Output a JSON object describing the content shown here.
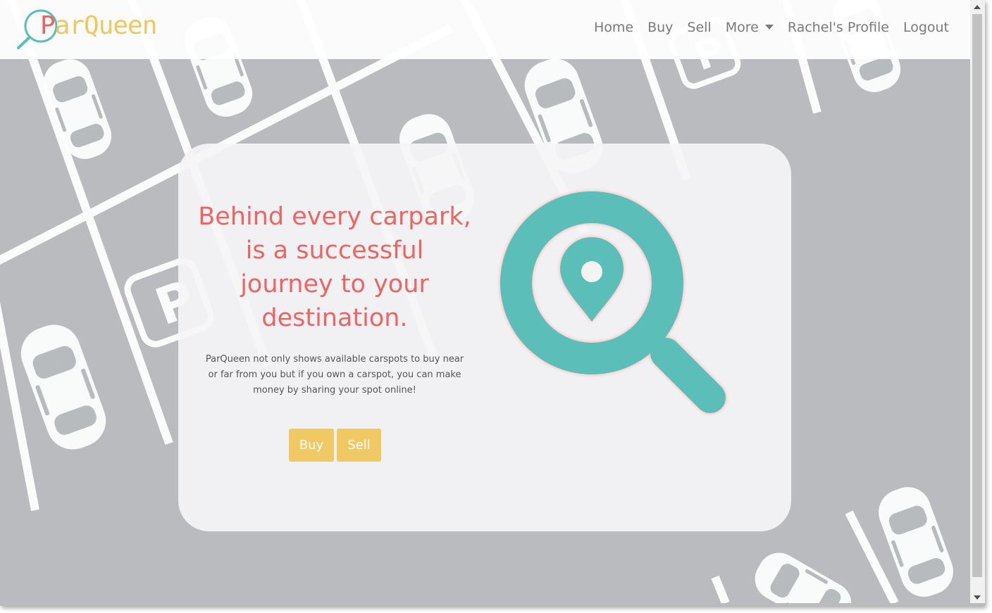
{
  "brand": {
    "name_first_letter": "P",
    "name_rest": "arQueen",
    "icon": "magnifier-logo-icon"
  },
  "nav": {
    "home": "Home",
    "buy": "Buy",
    "sell": "Sell",
    "more": "More",
    "profile": "Rachel's Profile",
    "logout": "Logout"
  },
  "hero": {
    "headline": "Behind every carpark, is a successful journey to your destination.",
    "description": "ParQueen not only shows available carspots to buy near or far from you but if you own a carspot, you can make money by sharing your spot online!",
    "buy_button": "Buy",
    "sell_button": "Sell",
    "illustration": "search-location-icon"
  },
  "background": "parking-lot-cars-pattern",
  "colors": {
    "accent_red": "#ed6464",
    "accent_yellow": "#f0c965",
    "accent_teal": "#5bbeb8",
    "background_gray": "#b9bbbe"
  }
}
